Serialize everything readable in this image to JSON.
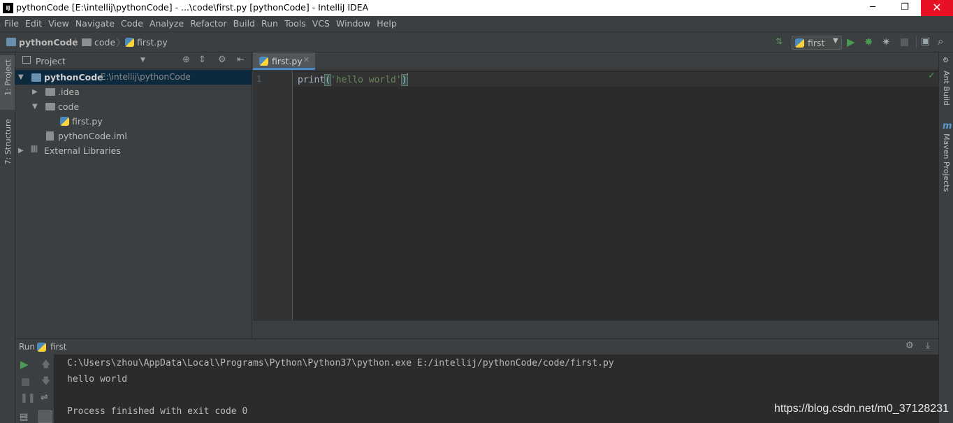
{
  "window": {
    "title": "pythonCode [E:\\intellij\\pythonCode] - ...\\code\\first.py [pythonCode] - IntelliJ IDEA",
    "icon_label": "IJ",
    "minimize": "─",
    "restore": "❐",
    "close": "✕"
  },
  "menu": [
    "File",
    "Edit",
    "View",
    "Navigate",
    "Code",
    "Analyze",
    "Refactor",
    "Build",
    "Run",
    "Tools",
    "VCS",
    "Window",
    "Help"
  ],
  "breadcrumb": {
    "project": "pythonCode",
    "folder": "code",
    "file": "first.py"
  },
  "toolbar": {
    "run_config": "first",
    "icons": [
      "build-icon",
      "run-icon",
      "debug-icon",
      "coverage-icon",
      "stop-icon",
      "project-structure-icon",
      "search-everywhere-icon"
    ]
  },
  "left_stripe": {
    "project_tab": "1: Project",
    "structure_tab": "7: Structure"
  },
  "right_stripe": {
    "ant_tab": "Ant Build",
    "maven_tab": "Maven Projects"
  },
  "project_panel": {
    "title": "Project",
    "tree": {
      "root_name": "pythonCode",
      "root_path": "E:\\intellij\\pythonCode",
      "idea": ".idea",
      "code": "code",
      "first": "first.py",
      "iml": "pythonCode.iml",
      "ext_libs": "External Libraries"
    }
  },
  "editor": {
    "tab_label": "first.py",
    "line_number": "1",
    "code": {
      "fn": "print",
      "open_paren": "(",
      "string": "'hello world'",
      "close_paren": ")"
    }
  },
  "run_panel": {
    "label": "Run",
    "config": "first",
    "console": {
      "line1": "C:\\Users\\zhou\\AppData\\Local\\Programs\\Python\\Python37\\python.exe E:/intellij/pythonCode/code/first.py",
      "line2": "hello world",
      "line3": "",
      "line4": "Process finished with exit code 0"
    }
  },
  "watermark": "https://blog.csdn.net/m0_37128231",
  "colors": {
    "background": "#3c3f41",
    "editor_bg": "#2b2b2b",
    "string": "#6a8759",
    "run_green": "#499c54",
    "selection": "#0d293e",
    "tab_accent": "#4a88c7"
  }
}
